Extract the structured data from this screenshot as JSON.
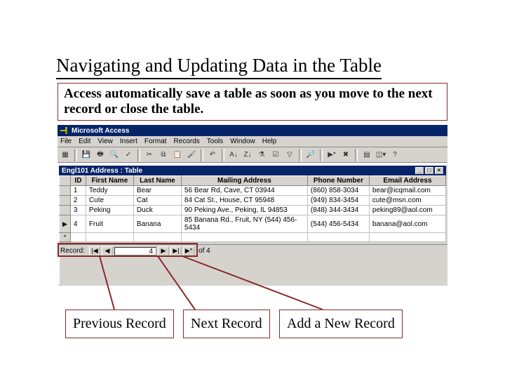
{
  "title": "Navigating and Updating Data in the Table",
  "subtitle": "Access automatically save a table as soon as you move to the next record or close the table.",
  "app": {
    "title": "Microsoft Access"
  },
  "menu": {
    "file": "File",
    "edit": "Edit",
    "view": "View",
    "insert": "Insert",
    "format": "Format",
    "records": "Records",
    "tools": "Tools",
    "window": "Window",
    "help": "Help"
  },
  "table_window": {
    "title": "Engl101 Address : Table"
  },
  "columns": {
    "rowhead": "",
    "id": "ID",
    "first_name": "First Name",
    "last_name": "Last Name",
    "mailing": "Mailing Address",
    "phone": "Phone Number",
    "email": "Email Address"
  },
  "rows": [
    {
      "marker": "",
      "id": "1",
      "first": "Teddy",
      "last": "Bear",
      "addr": "56 Bear Rd, Cave, CT 03944",
      "phone": "(860) 858-3034",
      "email": "bear@icqmail.com"
    },
    {
      "marker": "",
      "id": "2",
      "first": "Cute",
      "last": "Cat",
      "addr": "84 Cat St., House, CT 95948",
      "phone": "(949) 834-3454",
      "email": "cute@msn.com"
    },
    {
      "marker": "",
      "id": "3",
      "first": "Peking",
      "last": "Duck",
      "addr": "90 Peking Ave., Peking, IL 94853",
      "phone": "(848) 344-3434",
      "email": "peking89@aol.com"
    },
    {
      "marker": "▶",
      "id": "4",
      "first": "Fruit",
      "last": "Banana",
      "addr": "85 Banana Rd., Fruit, NY (544) 456-5434",
      "phone": "(544) 456-5434",
      "email": "banana@aol.com"
    },
    {
      "marker": "*",
      "id": "",
      "first": "",
      "last": "",
      "addr": "",
      "phone": "",
      "email": ""
    }
  ],
  "nav": {
    "label": "Record:",
    "first": "|◀",
    "prev": "◀",
    "current": "4",
    "next": "▶",
    "last": "▶|",
    "new": "▶*",
    "of": "of  4"
  },
  "labels": {
    "prev": "Previous Record",
    "next": "Next Record",
    "add": "Add a New Record"
  },
  "winbtns": {
    "min": "_",
    "max": "□",
    "close": "×"
  }
}
